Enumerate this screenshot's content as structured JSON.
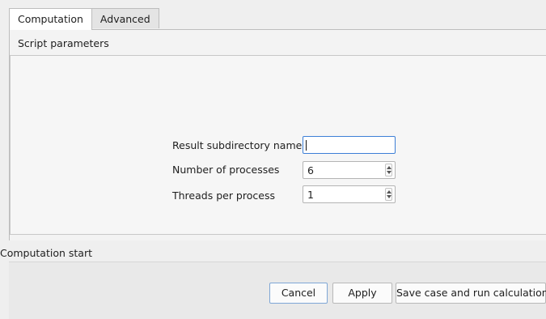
{
  "tabs": [
    {
      "label": "Computation",
      "active": true
    },
    {
      "label": "Advanced",
      "active": false
    }
  ],
  "script_parameters": {
    "title": "Script parameters",
    "result_subdirectory": {
      "label": "Result subdirectory name",
      "value": ""
    },
    "number_of_processes": {
      "label": "Number of processes",
      "value": "6"
    },
    "threads_per_process": {
      "label": "Threads per process",
      "value": "1"
    }
  },
  "computation_start": {
    "title": "Computation start",
    "cancel_label": "Cancel",
    "apply_label": "Apply",
    "save_run_label": "Save case and run calculation"
  },
  "colors": {
    "focus_border": "#3d7fd6",
    "background": "#efefef"
  }
}
